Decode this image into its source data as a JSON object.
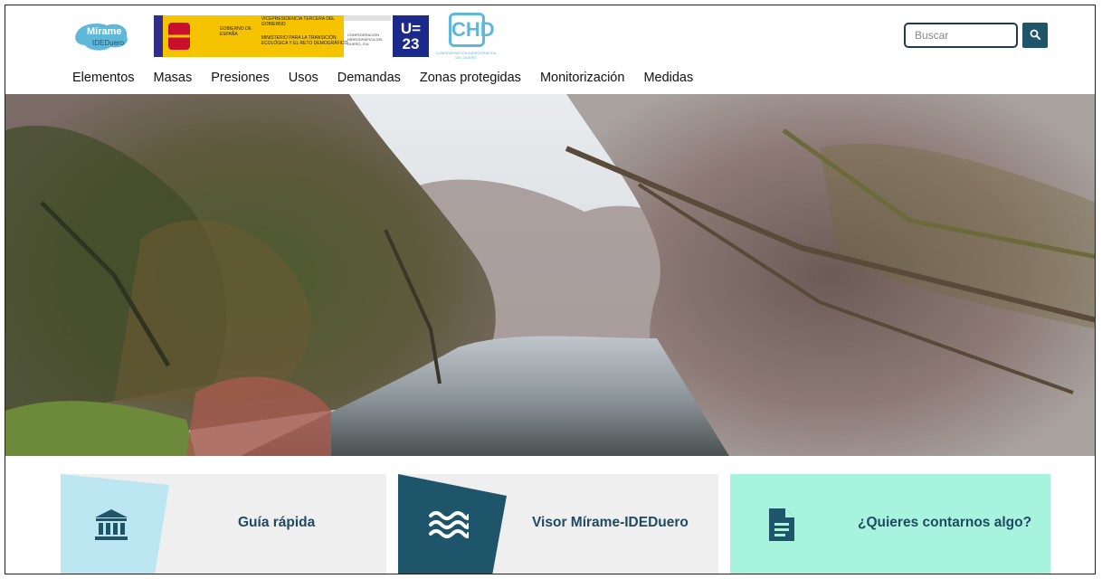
{
  "header": {
    "logo_mirame": {
      "line1": "Mírame",
      "line2": "IDEDuero"
    },
    "logo_gobierno": {
      "gobierno": "GOBIERNO DE ESPAÑA",
      "vicepresidencia": "VICEPRESIDENCIA TERCERA DEL GOBIERNO",
      "ministerio": "MINISTERIO PARA LA TRANSICIÓN ECOLÓGICA Y EL RETO DEMOGRÁFICO",
      "confederacion": "CONFEDERACIÓN HIDROGRÁFICA DEL DUERO, O.A."
    },
    "logo_u23": {
      "top": "U=",
      "bottom": "23"
    },
    "logo_chd": {
      "mark": "CHD",
      "sub": "CONFEDERACIÓN HIDROGRÁFICA DEL DUERO"
    },
    "search": {
      "placeholder": "Buscar",
      "button_icon": "search-icon"
    }
  },
  "nav": {
    "items": [
      "Elementos",
      "Masas",
      "Presiones",
      "Usos",
      "Demandas",
      "Zonas protegidas",
      "Monitorización",
      "Medidas"
    ]
  },
  "hero": {
    "image": "river-landscape-photo"
  },
  "cards": [
    {
      "label": "Guía rápida",
      "icon": "bank-building-icon",
      "accent": "#bde6f3",
      "icon_color": "#1f556b"
    },
    {
      "label": "Visor Mírame-IDEDuero",
      "icon": "water-waves-icon",
      "accent": "#1f556b",
      "icon_color": "#ffffff"
    },
    {
      "label": "¿Quieres contarnos algo?",
      "icon": "document-icon",
      "accent": "#a8f3dd",
      "icon_color": "#1f556b"
    }
  ],
  "colors": {
    "brand_dark": "#1f556b",
    "text_nav": "#111111",
    "card_bg": "#efefef",
    "card_mint": "#a8f3dd"
  }
}
